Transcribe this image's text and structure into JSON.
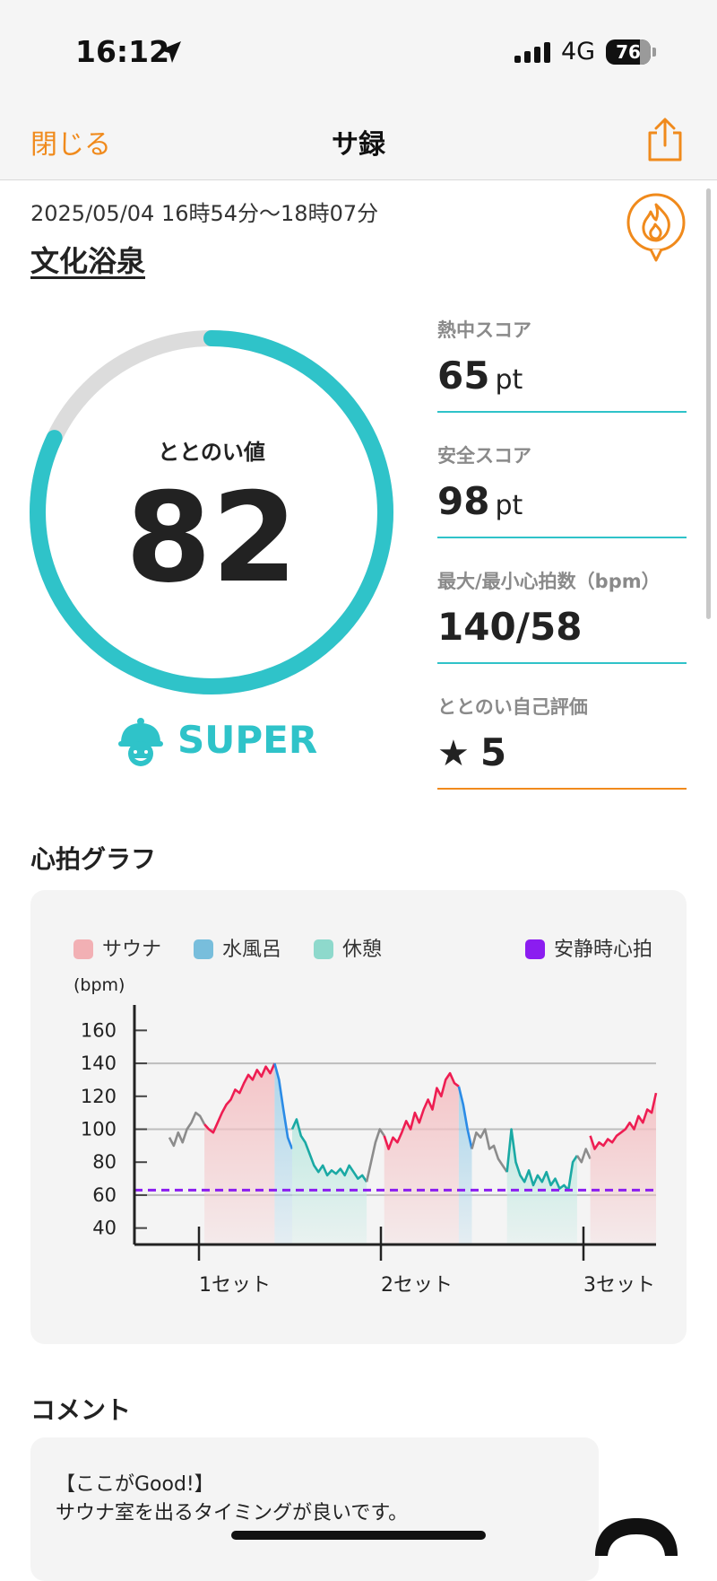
{
  "status_bar": {
    "time": "16:12",
    "network": "4G",
    "battery": "76"
  },
  "nav": {
    "close_label": "閉じる",
    "title": "サ録"
  },
  "session": {
    "datetime": "2025/05/04 16時54分〜18時07分",
    "facility": "文化浴泉"
  },
  "totonoi": {
    "label": "ととのい値",
    "value": "82",
    "level": "SUPER",
    "ring_fraction": 0.82
  },
  "stats": [
    {
      "label": "熱中スコア",
      "value": "65",
      "unit": "pt"
    },
    {
      "label": "安全スコア",
      "value": "98",
      "unit": "pt"
    },
    {
      "label": "最大/最小心拍数（bpm）",
      "value": "140/58",
      "unit": ""
    },
    {
      "label": "ととのい自己評価",
      "value": "5",
      "unit": ""
    }
  ],
  "heart_graph": {
    "title": "心拍グラフ"
  },
  "chart_data": {
    "type": "line",
    "ylabel": "(bpm)",
    "y_ticks": [
      160,
      140,
      120,
      100,
      80,
      60,
      40
    ],
    "ylim": [
      30,
      170
    ],
    "set_labels": [
      "1セット",
      "2セット",
      "3セット"
    ],
    "legend": [
      {
        "name": "サウナ",
        "color": "#f2b0b4"
      },
      {
        "name": "水風呂",
        "color": "#78bedc"
      },
      {
        "name": "休憩",
        "color": "#8ed9cc"
      },
      {
        "name": "安静時心拍",
        "color": "#8b1df0"
      }
    ],
    "resting_hr": 63,
    "series": [
      {
        "type": "other",
        "values": [
          95,
          90,
          98,
          92,
          100,
          104,
          110,
          108,
          103
        ]
      },
      {
        "type": "sauna",
        "values": [
          103,
          100,
          98,
          104,
          110,
          115,
          118,
          124,
          122,
          128,
          133,
          130,
          136,
          132,
          138,
          134,
          140
        ]
      },
      {
        "type": "water",
        "values": [
          140,
          130,
          112,
          95,
          88
        ]
      },
      {
        "type": "rest",
        "values": [
          100,
          106,
          96,
          92,
          85,
          78,
          74,
          78,
          72,
          75,
          73,
          76,
          72,
          78,
          74,
          70,
          72,
          68
        ]
      },
      {
        "type": "other",
        "values": [
          68,
          80,
          92,
          100,
          96
        ]
      },
      {
        "type": "sauna",
        "values": [
          96,
          88,
          95,
          92,
          98,
          105,
          100,
          110,
          104,
          112,
          118,
          112,
          125,
          120,
          130,
          134,
          128,
          126
        ]
      },
      {
        "type": "water",
        "values": [
          126,
          115,
          100,
          88
        ]
      },
      {
        "type": "other",
        "values": [
          88,
          98,
          95,
          100,
          88,
          90,
          82,
          78,
          74
        ]
      },
      {
        "type": "rest",
        "values": [
          74,
          100,
          80,
          72,
          68,
          75,
          66,
          72,
          68,
          74,
          66,
          70,
          64,
          66,
          63,
          80,
          84
        ]
      },
      {
        "type": "other",
        "values": [
          84,
          80,
          88,
          82
        ]
      },
      {
        "type": "sauna",
        "values": [
          96,
          88,
          92,
          90,
          94,
          92,
          96,
          98,
          100,
          104,
          100,
          108,
          104,
          112,
          110,
          122
        ]
      }
    ]
  },
  "comment": {
    "title": "コメント",
    "heading": "【ここがGood!】",
    "body": "サウナ室を出るタイミングが良いです。"
  },
  "icons": {
    "location": "location-arrow-icon",
    "share": "share-icon",
    "fire": "flame-badge-icon",
    "level": "sauna-hat-icon",
    "star": "star-icon",
    "avatar": "avatar-icon"
  },
  "colors": {
    "accent": "#f08a1c",
    "teal": "#2fc3c9",
    "sauna_line": "#ee1d52",
    "water_line": "#2b8be6",
    "rest_line": "#1aa9a4"
  }
}
